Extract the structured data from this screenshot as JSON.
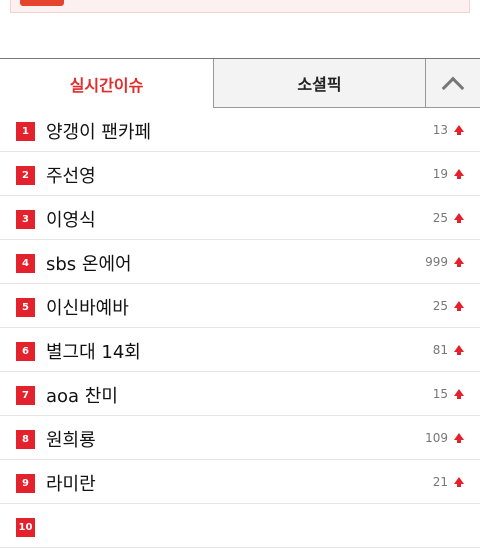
{
  "tabs": {
    "realtime": "실시간이슈",
    "social": "소셜픽"
  },
  "icons": {
    "collapse": "chevron-up-icon",
    "trend": "arrow-up-icon"
  },
  "colors": {
    "accent": "#e3222d",
    "active_tab_text": "#e02d2d"
  },
  "keywords": [
    {
      "rank": "1",
      "term": "양갱이 팬카페",
      "count": "13"
    },
    {
      "rank": "2",
      "term": "주선영",
      "count": "19"
    },
    {
      "rank": "3",
      "term": "이영식",
      "count": "25"
    },
    {
      "rank": "4",
      "term": "sbs 온에어",
      "count": "999"
    },
    {
      "rank": "5",
      "term": "이신바예바",
      "count": "25"
    },
    {
      "rank": "6",
      "term": "별그대 14회",
      "count": "81"
    },
    {
      "rank": "7",
      "term": "aoa 찬미",
      "count": "15"
    },
    {
      "rank": "8",
      "term": "원희룡",
      "count": "109"
    },
    {
      "rank": "9",
      "term": "라미란",
      "count": "21"
    },
    {
      "rank": "10",
      "term": "",
      "count": ""
    }
  ]
}
